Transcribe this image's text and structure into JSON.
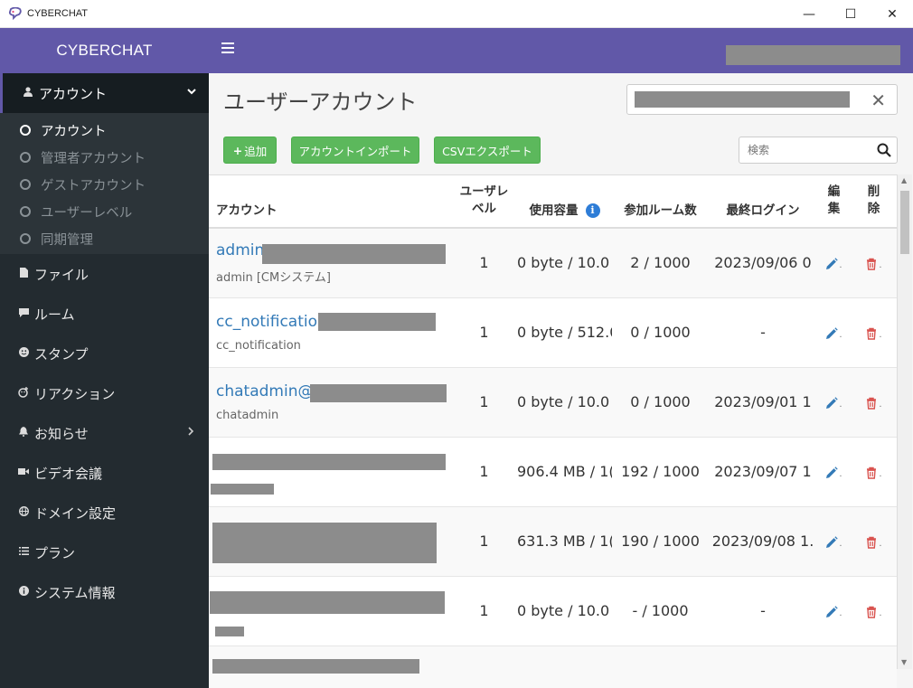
{
  "window": {
    "title": "CYBERCHAT",
    "minimize": "—",
    "maximize": "☐",
    "close": "✕"
  },
  "sidebar": {
    "brand": "CYBERCHAT",
    "account_menu": {
      "label": "アカウント",
      "icon": "user-icon",
      "expanded": true
    },
    "sub_items": [
      {
        "label": "アカウント",
        "active": true
      },
      {
        "label": "管理者アカウント",
        "active": false
      },
      {
        "label": "ゲストアカウント",
        "active": false
      },
      {
        "label": "ユーザーレベル",
        "active": false
      },
      {
        "label": "同期管理",
        "active": false
      }
    ],
    "items": [
      {
        "label": "ファイル",
        "icon": "file-icon"
      },
      {
        "label": "ルーム",
        "icon": "comment-icon"
      },
      {
        "label": "スタンプ",
        "icon": "smile-icon"
      },
      {
        "label": "リアクション",
        "icon": "reaction-icon"
      },
      {
        "label": "お知らせ",
        "icon": "bell-icon",
        "has_submenu": true
      },
      {
        "label": "ビデオ会議",
        "icon": "video-camera-icon"
      },
      {
        "label": "ドメイン設定",
        "icon": "globe-icon"
      },
      {
        "label": "プラン",
        "icon": "list-icon"
      },
      {
        "label": "システム情報",
        "icon": "info-circle-icon"
      }
    ]
  },
  "main": {
    "title": "ユーザーアカウント",
    "buttons": {
      "add": "追加",
      "import": "アカウントインポート",
      "export": "CSVエクスポート"
    },
    "filter_placeholder": "検索",
    "table": {
      "headers": {
        "account": "アカウント",
        "level_line1": "ユーザレ",
        "level_line2": "ベル",
        "storage": "使用容量",
        "rooms": "参加ルーム数",
        "last_login": "最終ログイン",
        "edit_line1": "編",
        "edit_line2": "集",
        "del_line1": "削",
        "del_line2": "除"
      },
      "rows": [
        {
          "id": "admin",
          "sub": "admin [CMシステム]",
          "level": "1",
          "storage": "0 byte / 10.0 (",
          "rooms": "2 / 1000",
          "last_login": "2023/09/06 0"
        },
        {
          "id": "cc_notification",
          "sub": "cc_notification",
          "level": "1",
          "storage": "0 byte / 512.0",
          "rooms": "0 / 1000",
          "last_login": "-"
        },
        {
          "id": "chatadmin@c",
          "sub": "chatadmin",
          "level": "1",
          "storage": "0 byte / 10.0 (",
          "rooms": "0 / 1000",
          "last_login": "2023/09/01 1"
        },
        {
          "id": "",
          "sub": "",
          "level": "1",
          "storage": "906.4 MB / 1(",
          "rooms": "192 / 1000",
          "last_login": "2023/09/07 1"
        },
        {
          "id": "",
          "sub": "",
          "level": "1",
          "storage": "631.3 MB / 1(",
          "rooms": "190 / 1000",
          "last_login": "2023/09/08 1."
        },
        {
          "id": "",
          "sub": "",
          "level": "1",
          "storage": "0 byte / 10.0 (",
          "rooms": "- / 1000",
          "last_login": "-"
        },
        {
          "id": "",
          "sub": "",
          "level": "",
          "storage": "",
          "rooms": "",
          "last_login": ""
        }
      ]
    }
  },
  "colors": {
    "brand": "#6158a8",
    "sidebar": "#232b30",
    "success": "#5cb85c",
    "link": "#337ab7",
    "danger": "#d9534f"
  }
}
